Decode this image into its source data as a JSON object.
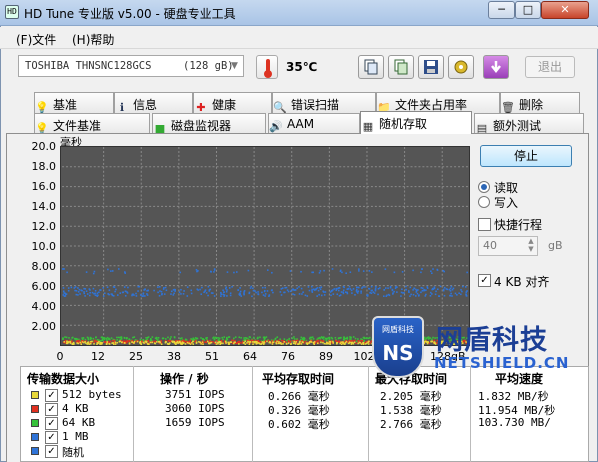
{
  "window": {
    "title": "HD Tune 专业版 v5.00 - 硬盘专业工具",
    "min_label": "─",
    "max_label": "□",
    "close_label": "✕"
  },
  "menu": {
    "file": "(F)文件",
    "help": "(H)帮助"
  },
  "toolbar": {
    "drive": "TOSHIBA THNSNC128GCS     (128 gB)",
    "temperature": "35℃",
    "exit_label": "退出"
  },
  "tabs_row1": [
    {
      "label": "基准",
      "icon": "lightbulb-icon"
    },
    {
      "label": "信息",
      "icon": "info-icon"
    },
    {
      "label": "健康",
      "icon": "health-cross-icon"
    },
    {
      "label": "错误扫描",
      "icon": "magnifier-icon"
    },
    {
      "label": "文件夹占用率",
      "icon": "folder-icon"
    },
    {
      "label": "删除",
      "icon": "trash-icon"
    }
  ],
  "tabs_row2": [
    {
      "label": "文件基准",
      "icon": "file-bulb-icon"
    },
    {
      "label": "磁盘监视器",
      "icon": "bar-chart-icon"
    },
    {
      "label": "AAM",
      "icon": "speaker-icon"
    },
    {
      "label": "随机存取",
      "icon": "random-access-icon",
      "active": true
    },
    {
      "label": "额外测试",
      "icon": "list-icon"
    }
  ],
  "chart_data": {
    "type": "scatter",
    "ylabel": "毫秒",
    "xlabel": "",
    "x_unit_label": "128gB",
    "ylim": [
      0,
      20
    ],
    "xlim": [
      0,
      128
    ],
    "yticks": [
      "20.0",
      "18.0",
      "16.0",
      "14.0",
      "12.0",
      "10.0",
      "8.00",
      "6.00",
      "4.00",
      "2.00"
    ],
    "xticks": [
      "0",
      "12",
      "25",
      "38",
      "51",
      "64",
      "76",
      "89",
      "102",
      "115"
    ],
    "grid": true,
    "series": [
      {
        "color": "#e8d83a",
        "band": [
          0.15,
          0.45
        ]
      },
      {
        "color": "#e03020",
        "band": [
          0.25,
          0.55
        ]
      },
      {
        "color": "#36c23a",
        "band": [
          0.45,
          0.9
        ]
      },
      {
        "color": "#2f74d8",
        "band": [
          5.0,
          6.0
        ]
      },
      {
        "color": "#2f74d8",
        "band": [
          7.3,
          7.8
        ]
      }
    ]
  },
  "controls": {
    "stop_label": "停止",
    "read_label": "读取",
    "write_label": "写入",
    "short_stroke_label": "快捷行程",
    "short_stroke_value": "40",
    "gb_unit": "gB",
    "align_label": "4 KB 对齐"
  },
  "stats": {
    "headers": [
      "传输数据大小",
      "操作 / 秒",
      "平均存取时间",
      "最大存取时间",
      "平均速度"
    ],
    "rows": [
      {
        "color": "#e8d83a",
        "size": "512 bytes",
        "ops": "3751 IOPS",
        "avg": "0.266 毫秒",
        "max": "2.205 毫秒",
        "speed": "1.832 MB/秒"
      },
      {
        "color": "#e03020",
        "size": "4 KB",
        "ops": "3060 IOPS",
        "avg": "0.326 毫秒",
        "max": "1.538 毫秒",
        "speed": "11.954 MB/秒"
      },
      {
        "color": "#36c23a",
        "size": "64 KB",
        "ops": "1659 IOPS",
        "avg": "0.602 毫秒",
        "max": "2.766 毫秒",
        "speed": "103.730 MB/"
      },
      {
        "color": "#2f74d8",
        "size": "1 MB",
        "ops": "",
        "avg": "",
        "max": "",
        "speed": ""
      },
      {
        "color": "#2f74d8",
        "size": "随机",
        "ops": "",
        "avg": "",
        "max": "",
        "speed": ""
      }
    ]
  },
  "watermark": {
    "cn": "网盾科技",
    "en": "NETSHIELD.CN",
    "shield_top": "网盾科技",
    "shield_letters": "NS"
  }
}
